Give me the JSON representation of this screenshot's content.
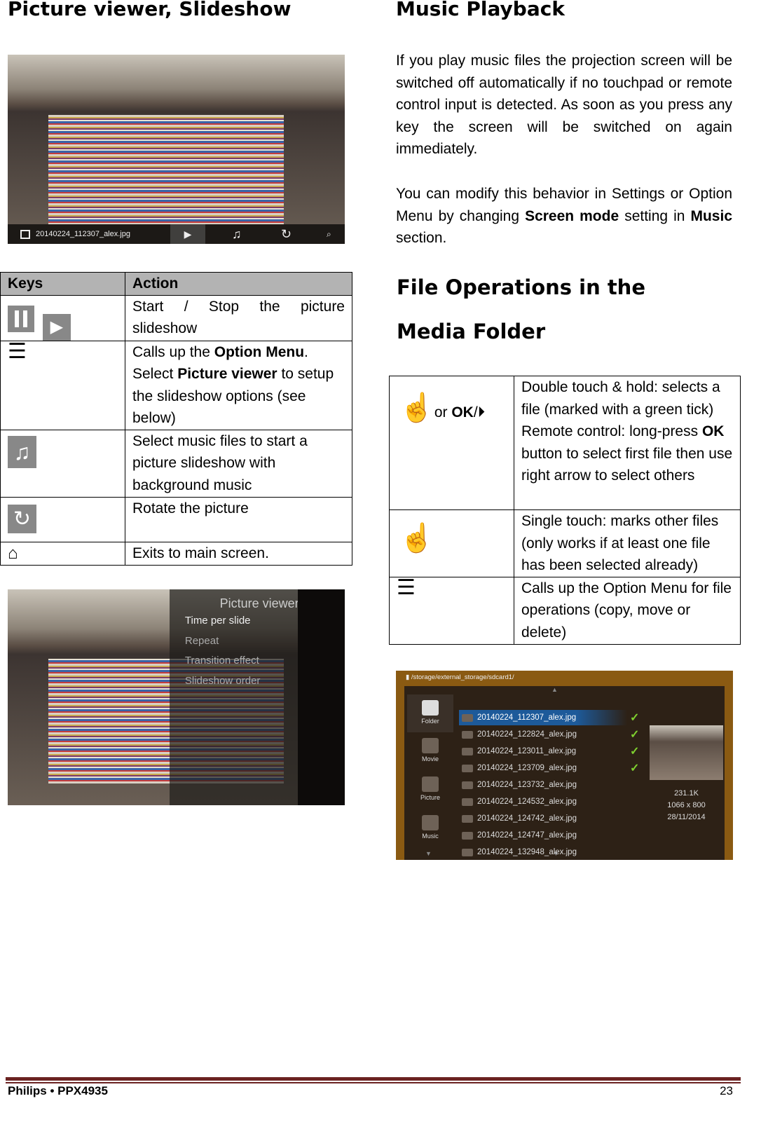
{
  "left": {
    "title": "Picture viewer, Slideshow",
    "viewer_bar": {
      "filename": "20140224_112307_alex.jpg"
    },
    "table": {
      "headers": [
        "Keys",
        "Action"
      ],
      "rows": [
        {
          "key_icons": [
            "pause-icon",
            "play-icon"
          ],
          "action": "Start / Stop the picture slideshow"
        },
        {
          "key_icons": [
            "menu-icon"
          ],
          "action_parts": [
            "Calls up the ",
            "Option Menu",
            ". Select ",
            "Picture viewer",
            " to setup the slideshow options (see below)"
          ]
        },
        {
          "key_icons": [
            "music-icon"
          ],
          "action": "Select music files to start a picture slideshow with background music"
        },
        {
          "key_icons": [
            "rotate-icon"
          ],
          "action": "Rotate the picture"
        },
        {
          "key_icons": [
            "home-icon"
          ],
          "action": "Exits to main screen."
        }
      ]
    },
    "menu": {
      "title": "Picture viewer",
      "items": [
        "Time per slide",
        "Repeat",
        "Transition effect",
        "Slideshow order"
      ]
    }
  },
  "right": {
    "title": "Music Playback",
    "para1": "If you play music files the projection screen will be switched off automatically if no touchpad or remote control input is detected. As soon as you press any key the screen will be switched on again immediately.",
    "para2_parts": [
      "You can modify this behavior in Settings or Option Menu by changing ",
      "Screen mode",
      " setting in ",
      "Music",
      " section."
    ],
    "title2_line1": "File Operations in the",
    "title2_line2": "Media Folder",
    "table": {
      "rows": [
        {
          "key_icons": [
            "double-tap-icon",
            "ok-play-icon"
          ],
          "key_text": [
            "or ",
            "OK",
            "/"
          ],
          "action_parts": [
            "Double touch & hold: selects a file (marked with a green tick) Remote control: long-press ",
            "OK",
            " button to select first file then use right arrow to select others"
          ]
        },
        {
          "key_icons": [
            "single-tap-icon"
          ],
          "action": "Single touch: marks other files (only works if at least one file has been selected already)"
        },
        {
          "key_icons": [
            "menu-icon"
          ],
          "action": "Calls up the Option Menu for file operations (copy, move or delete)"
        }
      ]
    },
    "browser": {
      "path": "/storage/external_storage/sdcard1/",
      "nav": [
        "Folder",
        "Movie",
        "Picture",
        "Music"
      ],
      "files": [
        "20140224_112307_alex.jpg",
        "20140224_122824_alex.jpg",
        "20140224_123011_alex.jpg",
        "20140224_123709_alex.jpg",
        "20140224_123732_alex.jpg",
        "20140224_124532_alex.jpg",
        "20140224_124742_alex.jpg",
        "20140224_124747_alex.jpg",
        "20140224_132948_alex.jpg"
      ],
      "checked_count": 4,
      "info": {
        "size": "231.1K",
        "resolution": "1066 x 800",
        "date": "28/11/2014"
      }
    }
  },
  "footer": {
    "left": "Philips • PPX4935",
    "page": "23",
    "bar_color": "#6b2322"
  }
}
